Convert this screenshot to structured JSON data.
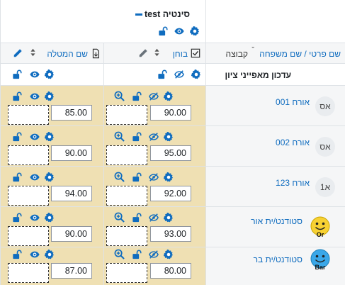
{
  "header": {
    "course_title": "test סינטיה",
    "first_last_label": "שם פרטי / שם משפחה",
    "group_label": "קבוצה",
    "quiz_label": "בוחן",
    "assignment_label": "שם המטלה",
    "overall_label": "עדכון מאפייני ציון"
  },
  "rows": [
    {
      "name": "אורח 001",
      "initials": "אס",
      "quiz_grade": "90.00",
      "assign_grade": "85.00",
      "avatar": "initials"
    },
    {
      "name": "אורח 002",
      "initials": "אס",
      "quiz_grade": "95.00",
      "assign_grade": "90.00",
      "avatar": "initials"
    },
    {
      "name": "אורח 123",
      "initials": "א1",
      "quiz_grade": "92.00",
      "assign_grade": "94.00",
      "avatar": "initials"
    },
    {
      "name": "סטודנט/ית אור",
      "initials": "Or",
      "quiz_grade": "93.00",
      "assign_grade": "90.00",
      "avatar": "smiley-yellow"
    },
    {
      "name": "סטודנט/ית בר",
      "initials": "Bar",
      "quiz_grade": "80.00",
      "assign_grade": "87.00",
      "avatar": "smiley-blue"
    }
  ],
  "colors": {
    "link": "#0f6cbf",
    "tan": "#efe0b3",
    "smiley_yellow": "#f7d133",
    "smiley_blue": "#3aa7e8"
  },
  "icons": [
    "collapse-icon",
    "gear-icon",
    "eye-icon",
    "eye-slash-icon",
    "unlock-icon",
    "pencil-icon",
    "zoom-icon",
    "checkbox-icon",
    "import-icon",
    "sort-icon"
  ]
}
